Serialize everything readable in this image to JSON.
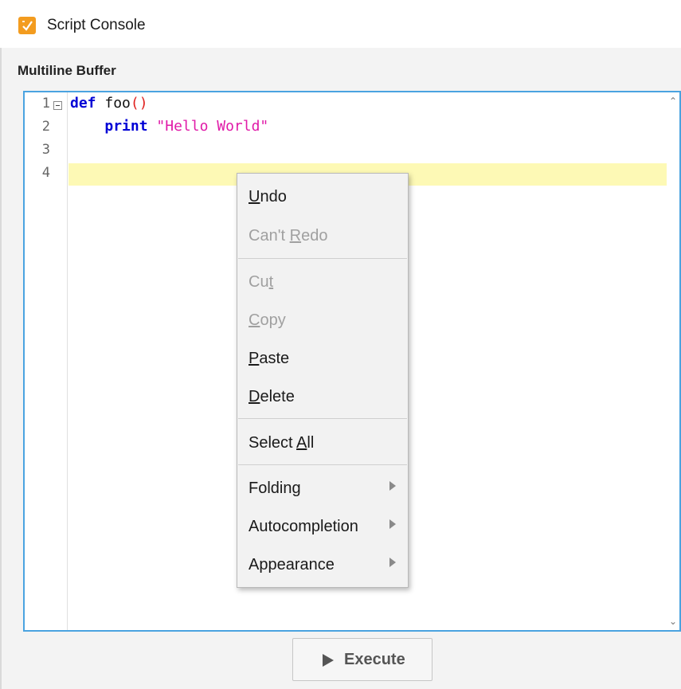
{
  "window": {
    "title": "Script Console",
    "icon": "script-console-icon"
  },
  "section": {
    "label": "Multiline Buffer"
  },
  "editor": {
    "line_numbers": [
      "1",
      "2",
      "3",
      "4"
    ],
    "lines": {
      "l1_kw": "def",
      "l1_name": " foo",
      "l1_parens": "()",
      "l2_indent": "    ",
      "l2_kw": "print",
      "l2_space": " ",
      "l2_string": "\"Hello World\""
    },
    "current_line": "4",
    "current_line_color": "#fdf9b5",
    "accent_color": "#4aa3e0"
  },
  "context_menu": {
    "undo": {
      "pre": "",
      "key": "U",
      "post": "ndo"
    },
    "redo": {
      "pre": "Can't ",
      "key": "R",
      "post": "edo"
    },
    "cut": {
      "pre": "Cu",
      "key": "t",
      "post": ""
    },
    "copy": {
      "pre": "",
      "key": "C",
      "post": "opy"
    },
    "paste": {
      "pre": "",
      "key": "P",
      "post": "aste"
    },
    "delete": {
      "pre": "",
      "key": "D",
      "post": "elete"
    },
    "select_all": {
      "pre": "Select ",
      "key": "A",
      "post": "ll"
    },
    "folding": "Folding",
    "autocompletion": "Autocompletion",
    "appearance": "Appearance"
  },
  "execute_button": {
    "label": "Execute",
    "icon": "play-icon"
  }
}
